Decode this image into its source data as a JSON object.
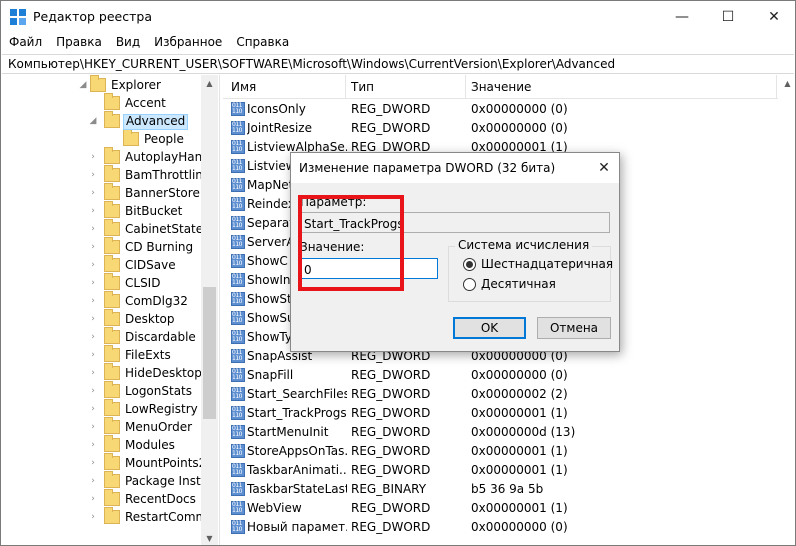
{
  "window": {
    "title": "Редактор реестра",
    "controls": {
      "minimize": "—",
      "maximize": "☐",
      "close": "✕"
    }
  },
  "menu": [
    "Файл",
    "Правка",
    "Вид",
    "Избранное",
    "Справка"
  ],
  "address": "Компьютер\\HKEY_CURRENT_USER\\SOFTWARE\\Microsoft\\Windows\\CurrentVersion\\Explorer\\Advanced",
  "tree": {
    "items": [
      {
        "label": "Explorer",
        "expanded": true
      },
      {
        "label": "Accent"
      },
      {
        "label": "Advanced",
        "selected": true,
        "expanded": true
      },
      {
        "label": "People"
      },
      {
        "label": "AutoplayHand"
      },
      {
        "label": "BamThrottling"
      },
      {
        "label": "BannerStore"
      },
      {
        "label": "BitBucket"
      },
      {
        "label": "CabinetState"
      },
      {
        "label": "CD Burning"
      },
      {
        "label": "CIDSave"
      },
      {
        "label": "CLSID"
      },
      {
        "label": "ComDlg32"
      },
      {
        "label": "Desktop"
      },
      {
        "label": "Discardable"
      },
      {
        "label": "FileExts"
      },
      {
        "label": "HideDesktopIc"
      },
      {
        "label": "LogonStats"
      },
      {
        "label": "LowRegistry"
      },
      {
        "label": "MenuOrder"
      },
      {
        "label": "Modules"
      },
      {
        "label": "MountPoints2"
      },
      {
        "label": "Package Instal"
      },
      {
        "label": "RecentDocs"
      },
      {
        "label": "RestartComm"
      }
    ]
  },
  "columns": {
    "name": "Имя",
    "type": "Тип",
    "data": "Значение"
  },
  "values": [
    {
      "name": "IconsOnly",
      "type": "REG_DWORD",
      "data": "0x00000000 (0)"
    },
    {
      "name": "JointResize",
      "type": "REG_DWORD",
      "data": "0x00000000 (0)"
    },
    {
      "name": "ListviewAlphaSe...",
      "type": "REG_DWORD",
      "data": "0x00000001 (1)"
    },
    {
      "name": "Listview",
      "type": "",
      "data": ""
    },
    {
      "name": "MapNet",
      "type": "",
      "data": ""
    },
    {
      "name": "Reindex",
      "type": "",
      "data": ""
    },
    {
      "name": "Separate",
      "type": "",
      "data": ""
    },
    {
      "name": "ServerA",
      "type": "",
      "data": ""
    },
    {
      "name": "ShowC",
      "type": "",
      "data": ""
    },
    {
      "name": "ShowIn",
      "type": "",
      "data": ""
    },
    {
      "name": "ShowSta",
      "type": "",
      "data": ""
    },
    {
      "name": "ShowSu",
      "type": "",
      "data": ""
    },
    {
      "name": "ShowTy",
      "type": "",
      "data": ""
    },
    {
      "name": "SnapAssist",
      "type": "REG_DWORD",
      "data": "0x00000000 (0)"
    },
    {
      "name": "SnapFill",
      "type": "REG_DWORD",
      "data": "0x00000000 (0)"
    },
    {
      "name": "Start_SearchFiles",
      "type": "REG_DWORD",
      "data": "0x00000002 (2)"
    },
    {
      "name": "Start_TrackProgs",
      "type": "REG_DWORD",
      "data": "0x00000001 (1)"
    },
    {
      "name": "StartMenuInit",
      "type": "REG_DWORD",
      "data": "0x0000000d (13)"
    },
    {
      "name": "StoreAppsOnTas...",
      "type": "REG_DWORD",
      "data": "0x00000001 (1)"
    },
    {
      "name": "TaskbarAnimati...",
      "type": "REG_DWORD",
      "data": "0x00000001 (1)"
    },
    {
      "name": "TaskbarStateLast...",
      "type": "REG_BINARY",
      "data": "b5 36 9a 5b"
    },
    {
      "name": "WebView",
      "type": "REG_DWORD",
      "data": "0x00000001 (1)"
    },
    {
      "name": "Новый парамет...",
      "type": "REG_DWORD",
      "data": "0x00000000 (0)"
    }
  ],
  "dialog": {
    "title": "Изменение параметра DWORD (32 бита)",
    "close": "✕",
    "param_label": "Параметр:",
    "param_value": "Start_TrackProgs",
    "value_label": "Значение:",
    "value": "0",
    "base_group": "Система исчисления",
    "base_options": [
      {
        "label": "Шестнадцатеричная",
        "checked": true
      },
      {
        "label": "Десятичная",
        "checked": false
      }
    ],
    "ok": "OK",
    "cancel": "Отмена"
  },
  "colors": {
    "highlight": "#e8141a",
    "selection": "#cce8ff",
    "accent": "#0078d7",
    "folder": "#f8d775"
  }
}
